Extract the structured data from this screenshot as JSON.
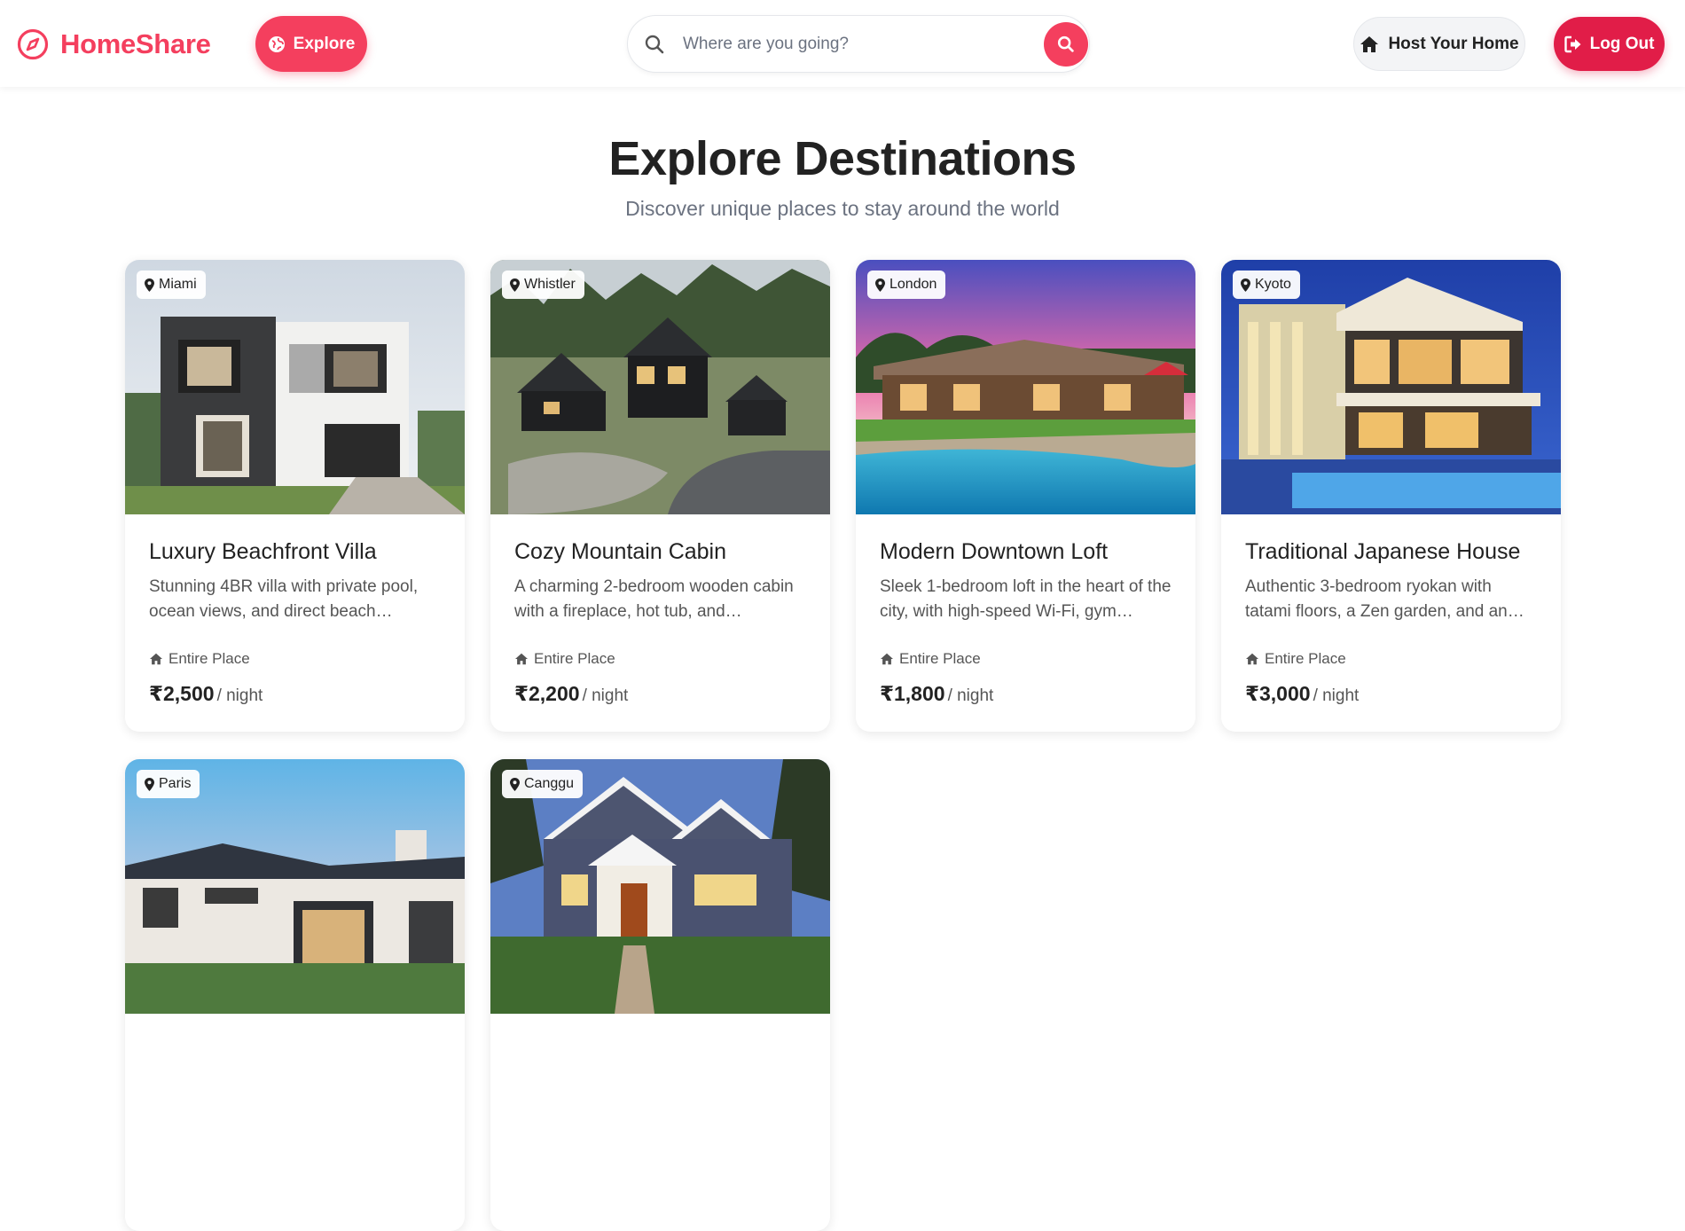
{
  "brand": {
    "name": "HomeShare",
    "color": "#f43f5e"
  },
  "header": {
    "explore_label": "Explore",
    "search_placeholder": "Where are you going?",
    "host_label": "Host Your Home",
    "logout_label": "Log Out"
  },
  "hero": {
    "title": "Explore Destinations",
    "subtitle": "Discover unique places to stay around the world"
  },
  "listings": [
    {
      "location": "Miami",
      "title": "Luxury Beachfront Villa",
      "description": "Stunning 4BR villa with private pool, ocean views, and direct beach…",
      "type": "Entire Place",
      "price": "₹2,500",
      "per": "/ night"
    },
    {
      "location": "Whistler",
      "title": "Cozy Mountain Cabin",
      "description": "A charming 2-bedroom wooden cabin with a fireplace, hot tub, and…",
      "type": "Entire Place",
      "price": "₹2,200",
      "per": "/ night"
    },
    {
      "location": "London",
      "title": "Modern Downtown Loft",
      "description": "Sleek 1-bedroom loft in the heart of the city, with high-speed Wi-Fi, gym…",
      "type": "Entire Place",
      "price": "₹1,800",
      "per": "/ night"
    },
    {
      "location": "Kyoto",
      "title": "Traditional Japanese House",
      "description": "Authentic 3-bedroom ryokan with tatami floors, a Zen garden, and an…",
      "type": "Entire Place",
      "price": "₹3,000",
      "per": "/ night"
    },
    {
      "location": "Paris"
    },
    {
      "location": "Canggu"
    }
  ]
}
